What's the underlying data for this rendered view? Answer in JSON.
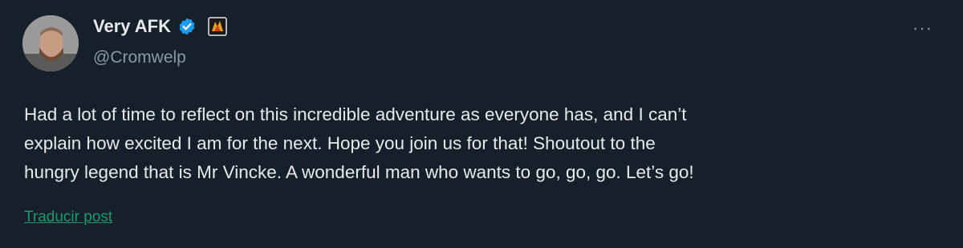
{
  "author": {
    "display_name": "Very AFK",
    "handle": "@Cromwelp",
    "verified_icon": "verified-badge-icon",
    "affiliate_icon": "affiliate-badge-icon",
    "avatar_icon": "avatar"
  },
  "menu": {
    "more_label": "···",
    "more_icon": "more-options-icon"
  },
  "tweet": {
    "lines": [
      "Had a lot of time to reflect on this incredible adventure as everyone has, and I can’t",
      "explain how excited I am for the next. Hope you join us for that! Shoutout to the",
      "hungry legend that is Mr Vincke. A wonderful man who wants to go, go, go. Let’s go!"
    ]
  },
  "translate_label": "Traducir post",
  "colors": {
    "background": "#15202b",
    "text": "#e7e9ea",
    "secondary": "#8b98a5",
    "verified": "#1d9bf0",
    "translate": "#1d9a6c"
  }
}
